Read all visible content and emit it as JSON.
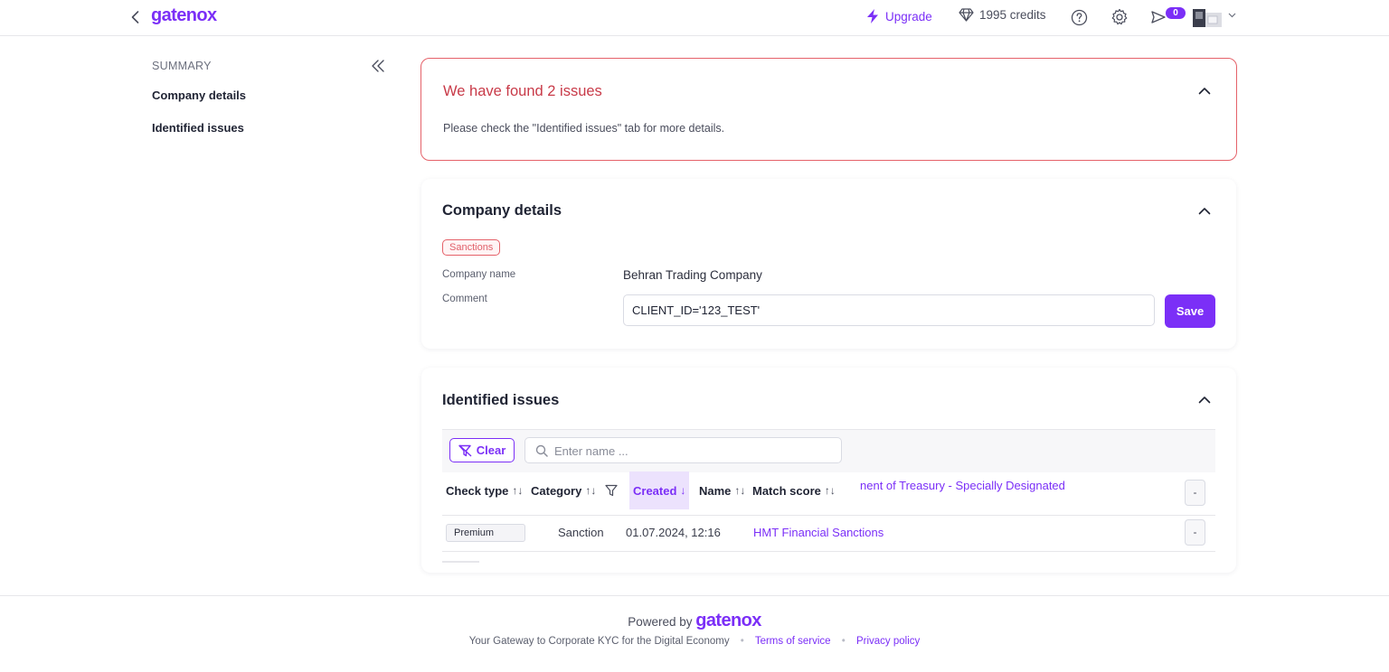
{
  "header": {
    "logo": "gatenox",
    "upgrade_label": "Upgrade",
    "credits_label": "1995 credits",
    "notification_count": "0"
  },
  "sidebar": {
    "heading": "SUMMARY",
    "items": [
      {
        "label": "Company details"
      },
      {
        "label": "Identified issues"
      }
    ]
  },
  "alert": {
    "title": "We have found 2 issues",
    "text": "Please check the \"Identified issues\" tab for more details."
  },
  "company": {
    "title": "Company details",
    "tag": "Sanctions",
    "name_label": "Company name",
    "name_value": "Behran Trading Company",
    "comment_label": "Comment",
    "comment_value": "CLIENT_ID='123_TEST'",
    "save_label": "Save"
  },
  "issues": {
    "title": "Identified issues",
    "clear_label": "Clear",
    "search_placeholder": "Enter name ...",
    "columns": [
      {
        "label": "Check type",
        "sort": "↑↓"
      },
      {
        "label": "Category",
        "sort": "↑↓"
      },
      {
        "label": "Created",
        "sort": "↓"
      },
      {
        "label": "Name",
        "sort": "↑↓"
      },
      {
        "label": "Match score",
        "sort": "↑↓"
      }
    ],
    "overflow_text": "nent of Treasury - Specially Designated",
    "rows": [
      {
        "check_type": "Premium",
        "category": "Sanction",
        "created": "01.07.2024, 12:16",
        "name": "HMT Financial Sanctions",
        "action": "-"
      }
    ],
    "first_row_action": "-"
  },
  "footer": {
    "powered_by": "Powered by",
    "logo": "gatenox",
    "tagline": "Your Gateway to Corporate KYC for the Digital Economy",
    "terms": "Terms of service",
    "privacy": "Privacy policy"
  },
  "colors": {
    "accent": "#7b2ff7",
    "alert_border": "#e5626a",
    "alert_text": "#c83a48"
  }
}
